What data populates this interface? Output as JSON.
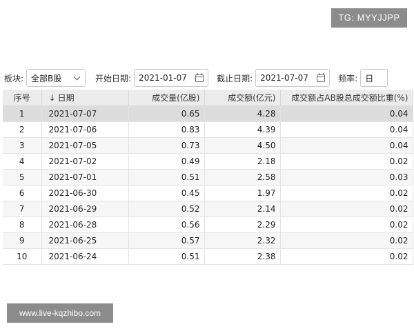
{
  "watermarks": {
    "top_right": "TG: MYYJJPP",
    "bottom_left": "www.live-kqzhibo.com"
  },
  "toolbar": {
    "block_label": "板块:",
    "block_value": "全部B股",
    "start_label": "开始日期:",
    "start_value": "2021-01-07",
    "end_label": "截止日期:",
    "end_value": "2021-07-07",
    "freq_label": "频率:",
    "freq_value": "日"
  },
  "table": {
    "headers": [
      "序号",
      "日期",
      "成交量(亿股)",
      "成交额(亿元)",
      "成交额占AB股总成交额比重(%)"
    ],
    "sort_arrow": "↓",
    "rows": [
      [
        "1",
        "2021-07-07",
        "0.65",
        "4.28",
        "0.04"
      ],
      [
        "2",
        "2021-07-06",
        "0.83",
        "4.39",
        "0.04"
      ],
      [
        "3",
        "2021-07-05",
        "0.73",
        "4.50",
        "0.04"
      ],
      [
        "4",
        "2021-07-02",
        "0.49",
        "2.18",
        "0.02"
      ],
      [
        "5",
        "2021-07-01",
        "0.51",
        "2.58",
        "0.03"
      ],
      [
        "6",
        "2021-06-30",
        "0.45",
        "1.97",
        "0.02"
      ],
      [
        "7",
        "2021-06-29",
        "0.52",
        "2.14",
        "0.02"
      ],
      [
        "8",
        "2021-06-28",
        "0.56",
        "2.29",
        "0.02"
      ],
      [
        "9",
        "2021-06-25",
        "0.57",
        "2.32",
        "0.02"
      ],
      [
        "10",
        "2021-06-24",
        "0.51",
        "2.38",
        "0.02"
      ]
    ]
  }
}
